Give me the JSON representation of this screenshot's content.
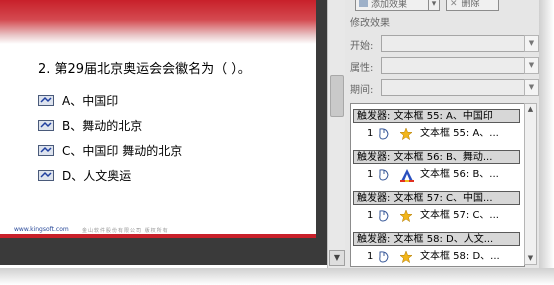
{
  "toolbar": {
    "add_effect_label": "添加效果",
    "delete_label": "删除"
  },
  "panel": {
    "section_title": "修改效果",
    "start_label": "开始:",
    "property_label": "属性:",
    "duration_label": "期间:"
  },
  "slide": {
    "question": "2. 第29届北京奥运会会徽名为（  ）。",
    "options": [
      "A、中国印",
      "B、舞动的北京",
      "C、中国印 舞动的北京",
      "D、人文奥运"
    ],
    "footer_url": "www.kingsoft.com",
    "footer_text": "金山软件股份有限公司 版权所有"
  },
  "animation_list": [
    {
      "trigger": "触发器: 文本框 55: A、中国印",
      "effect_num": "1",
      "effect_text": "文本框 55: A、..."
    },
    {
      "trigger": "触发器: 文本框 56: B、舞动...",
      "effect_num": "1",
      "effect_text": "文本框 56: B、..."
    },
    {
      "trigger": "触发器: 文本框 57: C、中国...",
      "effect_num": "1",
      "effect_text": "文本框 57: C、..."
    },
    {
      "trigger": "触发器: 文本框 58: D、人文...",
      "effect_num": "1",
      "effect_text": "文本框 58: D、..."
    }
  ],
  "icons": {
    "option_bullet": "option-bullet-icon",
    "mouse": "mouse-click-icon",
    "star": "star-effect-icon",
    "font": "font-color-icon"
  },
  "colors": {
    "slide_band": "#c8202a",
    "trigger_bg": "#d7d7d7",
    "panel_bg": "#e6e6e6"
  }
}
